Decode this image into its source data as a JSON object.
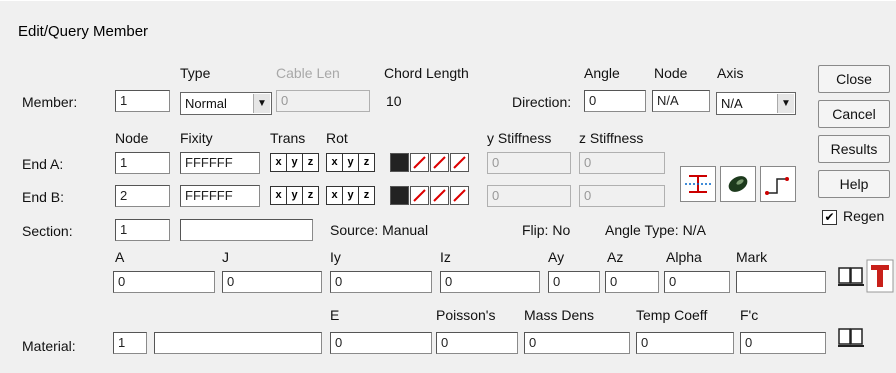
{
  "window": {
    "title": "Edit/Query Member"
  },
  "header": {
    "type": "Type",
    "cable_len": "Cable Len",
    "chord_length": "Chord Length",
    "angle": "Angle",
    "node": "Node",
    "axis": "Axis"
  },
  "member": {
    "label": "Member:",
    "id": "1",
    "type": "Normal",
    "cable_len": "0",
    "chord_length": "10",
    "direction_label": "Direction:",
    "direction": "0",
    "node": "N/A",
    "axis": "N/A"
  },
  "ends_header": {
    "node": "Node",
    "fixity": "Fixity",
    "trans": "Trans",
    "rot": "Rot",
    "y_stiffness": "y Stiffness",
    "z_stiffness": "z Stiffness"
  },
  "end_a": {
    "label": "End A:",
    "node": "1",
    "fixity": "FFFFFF",
    "y_stiff": "0",
    "z_stiff": "0"
  },
  "end_b": {
    "label": "End B:",
    "node": "2",
    "fixity": "FFFFFF",
    "y_stiff": "0",
    "z_stiff": "0"
  },
  "toggles": {
    "x": "x",
    "y": "y",
    "z": "z"
  },
  "section": {
    "label": "Section:",
    "id": "1",
    "name": "",
    "source": "Source: Manual",
    "flip": "Flip: No",
    "angle_type": "Angle Type: N/A"
  },
  "properties": {
    "headers": [
      "A",
      "J",
      "Iy",
      "Iz",
      "Ay",
      "Az",
      "Alpha",
      "Mark"
    ],
    "values": [
      "0",
      "0",
      "0",
      "0",
      "0",
      "0",
      "0",
      ""
    ]
  },
  "material": {
    "label": "Material:",
    "id": "1",
    "name": "",
    "headers": [
      "E",
      "Poisson's",
      "Mass Dens",
      "Temp Coeff",
      "F'c"
    ],
    "values": [
      "0",
      "0",
      "0",
      "0",
      "0"
    ]
  },
  "buttons": {
    "close": "Close",
    "cancel": "Cancel",
    "results": "Results",
    "help": "Help"
  },
  "regen": {
    "label": "Regen",
    "checked": "✔"
  }
}
